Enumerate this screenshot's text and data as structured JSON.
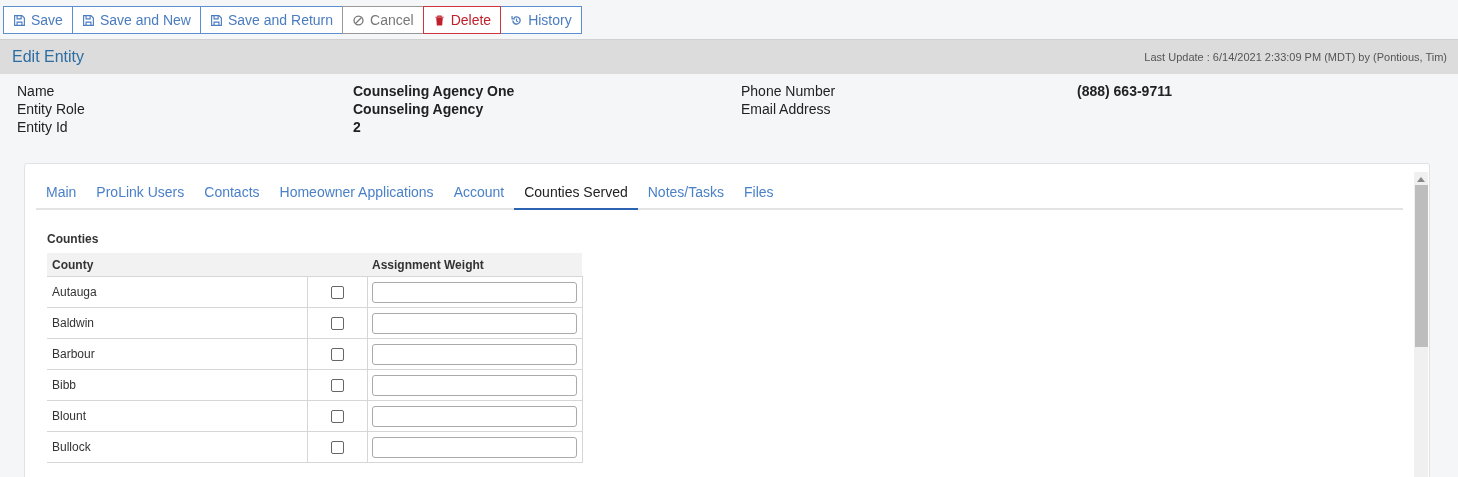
{
  "toolbar": [
    {
      "kind": "save",
      "label": "Save"
    },
    {
      "kind": "save",
      "label": "Save and New"
    },
    {
      "kind": "save",
      "label": "Save and Return"
    },
    {
      "kind": "cancel",
      "label": "Cancel"
    },
    {
      "kind": "delete",
      "label": "Delete"
    },
    {
      "kind": "history",
      "label": "History"
    }
  ],
  "header": {
    "title": "Edit Entity",
    "last_update": "Last Update : 6/14/2021 2:33:09 PM (MDT) by (Pontious, Tim)"
  },
  "details_left": [
    {
      "label": "Name",
      "value": "Counseling Agency One"
    },
    {
      "label": "Entity Role",
      "value": "Counseling Agency"
    },
    {
      "label": "Entity Id",
      "value": "2"
    }
  ],
  "details_right": [
    {
      "label": "Phone Number",
      "value": "(888) 663-9711"
    },
    {
      "label": "Email Address"
    }
  ],
  "tabs": [
    {
      "label": "Main",
      "selected": false
    },
    {
      "label": "ProLink Users",
      "selected": false
    },
    {
      "label": "Contacts",
      "selected": false
    },
    {
      "label": "Homeowner Applications",
      "selected": false
    },
    {
      "label": "Account",
      "selected": false
    },
    {
      "label": "Counties Served",
      "selected": true
    },
    {
      "label": "Notes/Tasks",
      "selected": false
    },
    {
      "label": "Files",
      "selected": false
    }
  ],
  "section_title": "Counties",
  "table": {
    "columns": [
      "County",
      "Assignment Weight"
    ],
    "rows": [
      {
        "county": "Autauga",
        "checked": false
      },
      {
        "county": "Baldwin",
        "checked": false
      },
      {
        "county": "Barbour",
        "checked": false
      },
      {
        "county": "Bibb",
        "checked": false
      },
      {
        "county": "Blount",
        "checked": false
      },
      {
        "county": "Bullock",
        "checked": false
      }
    ]
  }
}
